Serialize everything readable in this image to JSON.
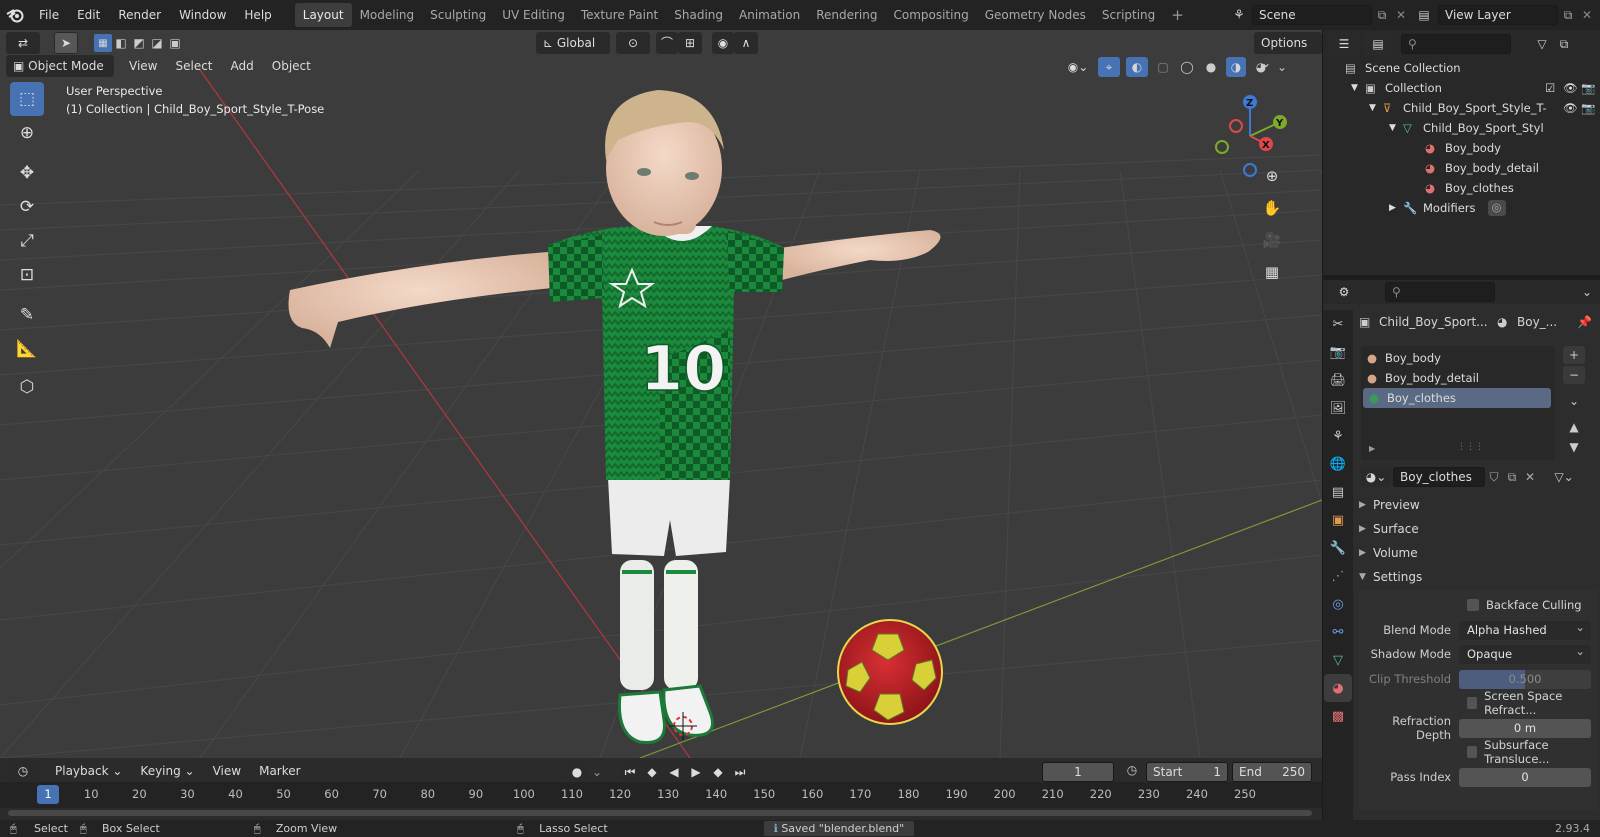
{
  "app": {
    "logo": "blender-logo-icon",
    "version": "2.93.4"
  },
  "menu": [
    "File",
    "Edit",
    "Render",
    "Window",
    "Help"
  ],
  "workspaces": [
    "Layout",
    "Modeling",
    "Sculpting",
    "UV Editing",
    "Texture Paint",
    "Shading",
    "Animation",
    "Rendering",
    "Compositing",
    "Geometry Nodes",
    "Scripting"
  ],
  "active_workspace": "Layout",
  "scene": {
    "name": "Scene",
    "view_layer": "View Layer"
  },
  "viewport_header": {
    "mode": "Object Mode",
    "menus": [
      "View",
      "Select",
      "Add",
      "Object"
    ],
    "transform_orientation": "Global",
    "options": "Options"
  },
  "viewport": {
    "perspective": "User Perspective",
    "collection_info": "(1) Collection | Child_Boy_Sport_Style_T-Pose",
    "gizmo": {
      "z": "Z",
      "y": "Y",
      "x": "X"
    },
    "jersey_number": "10"
  },
  "outliner": {
    "rows": [
      {
        "label": "Scene Collection",
        "icon": "scene-collection-icon"
      },
      {
        "label": "Collection",
        "icon": "collection-icon"
      },
      {
        "label": "Child_Boy_Sport_Style_T-",
        "icon": "armature-icon"
      },
      {
        "label": "Child_Boy_Sport_Styl",
        "icon": "mesh-icon"
      },
      {
        "label": "Boy_body",
        "icon": "material-icon"
      },
      {
        "label": "Boy_body_detail",
        "icon": "material-icon"
      },
      {
        "label": "Boy_clothes",
        "icon": "material-icon"
      },
      {
        "label": "Modifiers",
        "icon": "wrench-icon"
      }
    ]
  },
  "properties": {
    "object_name": "Child_Boy_Sport...",
    "material_short": "Boy_...",
    "material_slots": [
      "Boy_body",
      "Boy_body_detail",
      "Boy_clothes"
    ],
    "selected_slot": "Boy_clothes",
    "material_name": "Boy_clothes",
    "panels": [
      "Preview",
      "Surface",
      "Volume",
      "Settings"
    ],
    "settings": {
      "backface_culling_label": "Backface Culling",
      "backface_culling": false,
      "blend_mode_label": "Blend Mode",
      "blend_mode": "Alpha Hashed",
      "shadow_mode_label": "Shadow Mode",
      "shadow_mode": "Opaque",
      "clip_threshold_label": "Clip Threshold",
      "clip_threshold": "0.500",
      "clip_threshold_fraction": 0.5,
      "ssr_label": "Screen Space Refract...",
      "refraction_depth_label": "Refraction Depth",
      "refraction_depth": "0 m",
      "sss_label": "Subsurface Transluce...",
      "pass_index_label": "Pass Index",
      "pass_index": "0"
    }
  },
  "timeline": {
    "menus": [
      "Playback",
      "Keying",
      "View",
      "Marker"
    ],
    "current_frame": "1",
    "start_label": "Start",
    "start": "1",
    "end_label": "End",
    "end": "250",
    "ticks": [
      "1",
      "10",
      "20",
      "30",
      "40",
      "50",
      "60",
      "70",
      "80",
      "90",
      "100",
      "110",
      "120",
      "130",
      "140",
      "150",
      "160",
      "170",
      "180",
      "190",
      "200",
      "210",
      "220",
      "230",
      "240",
      "250"
    ]
  },
  "statusbar": {
    "select": "Select",
    "box_select": "Box Select",
    "zoom_view": "Zoom View",
    "lasso_select": "Lasso Select",
    "message": "Saved \"blender.blend\""
  },
  "colors": {
    "accent": "#4772b3",
    "viewport_bg": "#3c3c3c",
    "jersey": "#1e8a3e",
    "ball_red": "#c8242a",
    "ball_yellow": "#e8d840"
  }
}
